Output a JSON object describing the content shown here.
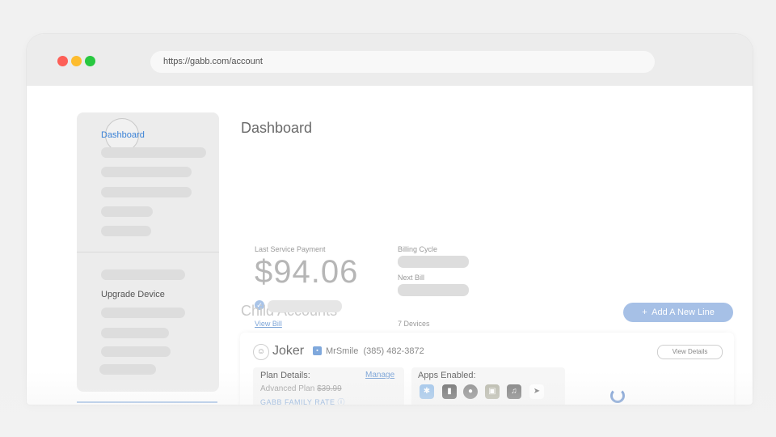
{
  "browser": {
    "url": "https://gabb.com/account"
  },
  "sidebar": {
    "active_item": "Dashboard",
    "upgrade_item": "Upgrade Device"
  },
  "dashboard": {
    "title": "Dashboard",
    "last_service_payment_label": "Last Service Payment",
    "amount": "$94.06",
    "view_bill": "View Bill",
    "billing_cycle_label": "Billing Cycle",
    "next_bill_label": "Next Bill",
    "devices_count": "7 Devices"
  },
  "child_accounts": {
    "title": "Child Accounts",
    "add_line_button": "Add A New Line",
    "card": {
      "name": "Joker",
      "username": "MrSmile",
      "phone": "(385) 482-3872",
      "view_details": "View Details",
      "plan_details_label": "Plan Details:",
      "manage_link": "Manage",
      "plan_name": "Advanced Plan",
      "plan_old_price": "$39.99",
      "family_rate": "GABB FAMILY RATE",
      "apps_enabled_label": "Apps Enabled:"
    }
  },
  "colors": {
    "accent": "#3b82d6",
    "button": "#a6c0e6",
    "close": "#fd5f57",
    "minimize": "#fdbc2e",
    "maximize": "#28c840"
  }
}
